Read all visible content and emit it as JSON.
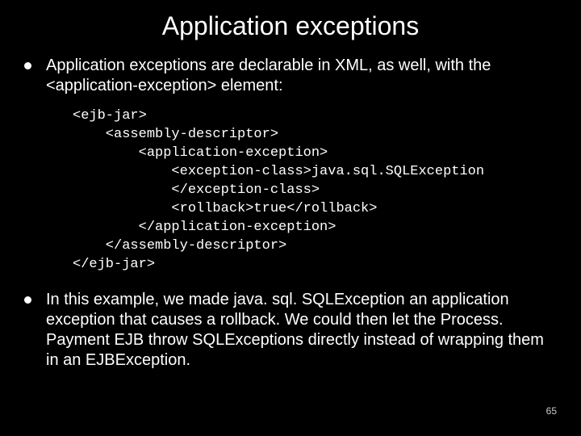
{
  "title": "Application exceptions",
  "bullets": {
    "b1": "Application exceptions are declarable in XML, as well, with the <application-exception> element:",
    "b2": "In this example, we made java. sql. SQLException an application exception that causes a rollback. We could then let the Process. Payment EJB throw SQLExceptions directly instead of wrapping them in an EJBException."
  },
  "code": {
    "l1": "<ejb-jar>",
    "l2": "    <assembly-descriptor>",
    "l3": "        <application-exception>",
    "l4": "            <exception-class>java.sql.SQLException",
    "l5": "            </exception-class>",
    "l6": "            <rollback>true</rollback>",
    "l7": "        </application-exception>",
    "l8": "    </assembly-descriptor>",
    "l9": "</ejb-jar>"
  },
  "pageNumber": "65"
}
